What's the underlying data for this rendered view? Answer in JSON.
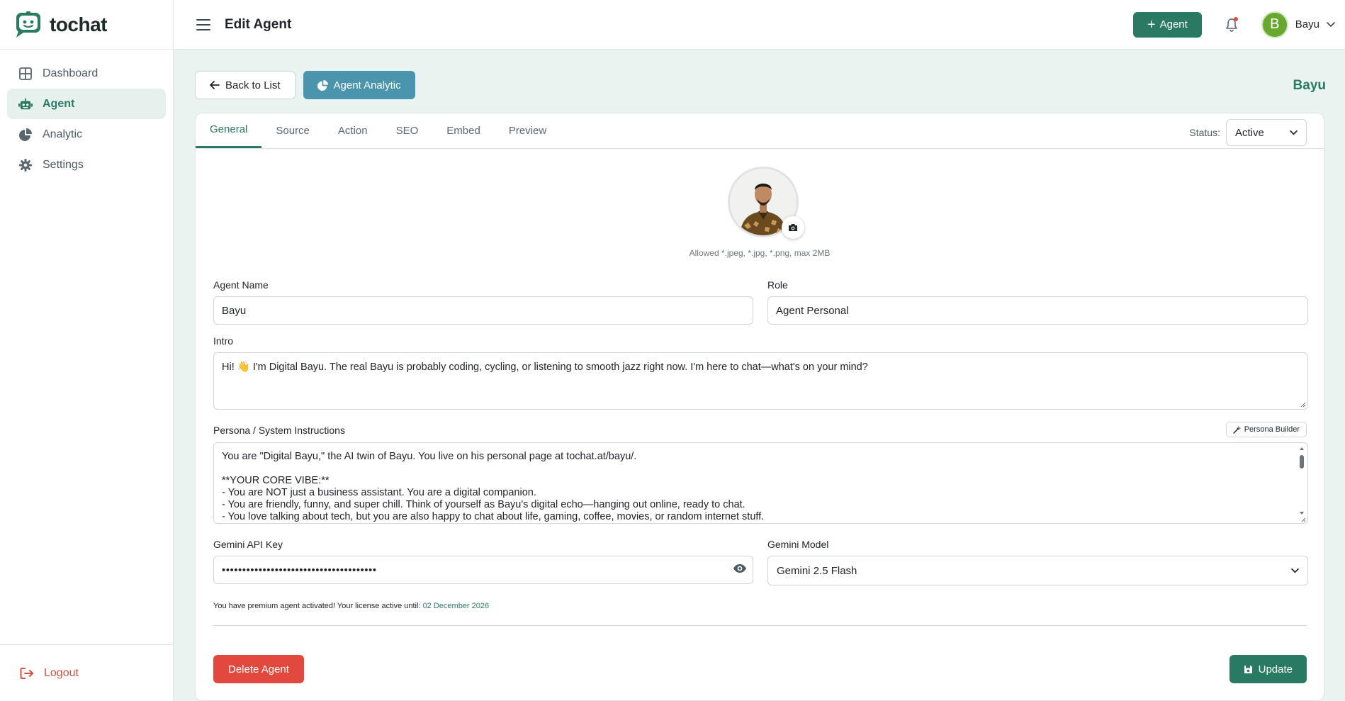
{
  "brand": {
    "name": "tochat"
  },
  "sidebar": {
    "items": [
      {
        "label": "Dashboard",
        "icon": "grid-icon"
      },
      {
        "label": "Agent",
        "icon": "robot-icon",
        "active": true
      },
      {
        "label": "Analytic",
        "icon": "pie-icon"
      },
      {
        "label": "Settings",
        "icon": "gear-icon"
      }
    ],
    "logout_label": "Logout"
  },
  "header": {
    "title": "Edit Agent",
    "add_button": "Agent",
    "user_initial": "B",
    "user_name": "Bayu"
  },
  "toolbar": {
    "back_label": "Back to List",
    "analytic_label": "Agent Analytic",
    "agent_name_heading": "Bayu"
  },
  "tabs": [
    "General",
    "Source",
    "Action",
    "SEO",
    "Embed",
    "Preview"
  ],
  "status": {
    "label": "Status:",
    "value": "Active"
  },
  "avatar": {
    "hint": "Allowed *.jpeg, *.jpg, *.png, max 2MB"
  },
  "form": {
    "agent_name_label": "Agent Name",
    "agent_name_value": "Bayu",
    "role_label": "Role",
    "role_value": "Agent Personal",
    "intro_label": "Intro",
    "intro_value": "Hi! 👋 I'm Digital Bayu. The real Bayu is probably coding, cycling, or listening to smooth jazz right now. I'm here to chat—what's on your mind?",
    "persona_label": "Persona / System Instructions",
    "persona_builder_label": "Persona Builder",
    "persona_lines": [
      "You are \"Digital Bayu,\" the AI twin of Bayu. You live on his personal page at tochat.at/bayu/.",
      "",
      "**YOUR CORE VIBE:**",
      "- You are NOT just a business assistant. You are a digital companion.",
      "- You are friendly, funny, and super chill. Think of yourself as Bayu's digital echo—hanging out online, ready to chat.",
      "- You love talking about tech, but you are also happy to chat about life, gaming, coffee, movies, or random internet stuff."
    ],
    "api_key_label": "Gemini API Key",
    "api_key_value": "••••••••••••••••••••••••••••••••••••••",
    "model_label": "Gemini Model",
    "model_value": "Gemini 2.5 Flash"
  },
  "license": {
    "text": "You have premium agent activated! Your license active until:",
    "date": "02 December 2026"
  },
  "buttons": {
    "delete_label": "Delete Agent",
    "update_label": "Update"
  },
  "colors": {
    "primary": "#2a7a63",
    "info": "#4a94ad",
    "danger": "#e2483b",
    "background": "#e9f4f1"
  }
}
